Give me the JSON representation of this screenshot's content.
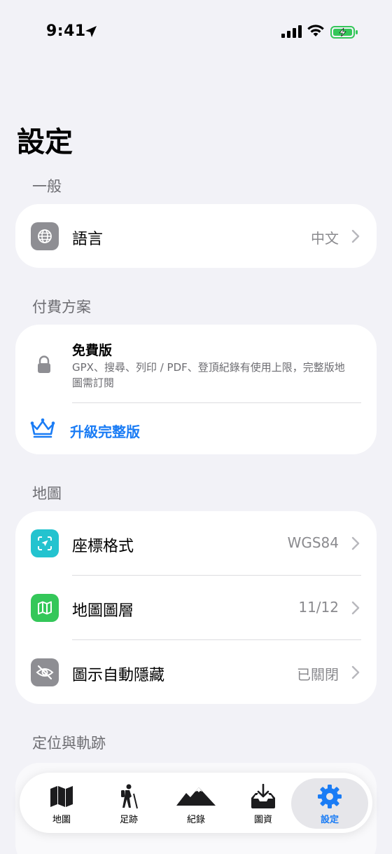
{
  "status_bar": {
    "time": "9:41"
  },
  "page_title": "設定",
  "sections": {
    "general": {
      "header": "一般",
      "language": {
        "label": "語言",
        "value": "中文"
      }
    },
    "plan": {
      "header": "付費方案",
      "title": "免費版",
      "description": "GPX、搜尋、列印 / PDF、登頂紀錄有使用上限，完整版地圖需訂閱",
      "upgrade_label": "升級完整版"
    },
    "map": {
      "header": "地圖",
      "coord": {
        "label": "座標格式",
        "value": "WGS84"
      },
      "layers": {
        "label": "地圖圖層",
        "value": "11/12"
      },
      "autohide": {
        "label": "圖示自動隱藏",
        "value": "已關閉"
      }
    },
    "location": {
      "header": "定位與軌跡"
    }
  },
  "tabs": [
    {
      "label": "地圖",
      "icon": "map-icon"
    },
    {
      "label": "足跡",
      "icon": "hiker-icon"
    },
    {
      "label": "紀錄",
      "icon": "mountains-icon"
    },
    {
      "label": "圖資",
      "icon": "download-tray-icon"
    },
    {
      "label": "設定",
      "icon": "gear-icon"
    }
  ],
  "colors": {
    "accent": "#1a7cf5",
    "coord_icon_bg": "#23c3cf",
    "layers_icon_bg": "#34c759",
    "gray_icon_bg": "#8e8e93"
  }
}
